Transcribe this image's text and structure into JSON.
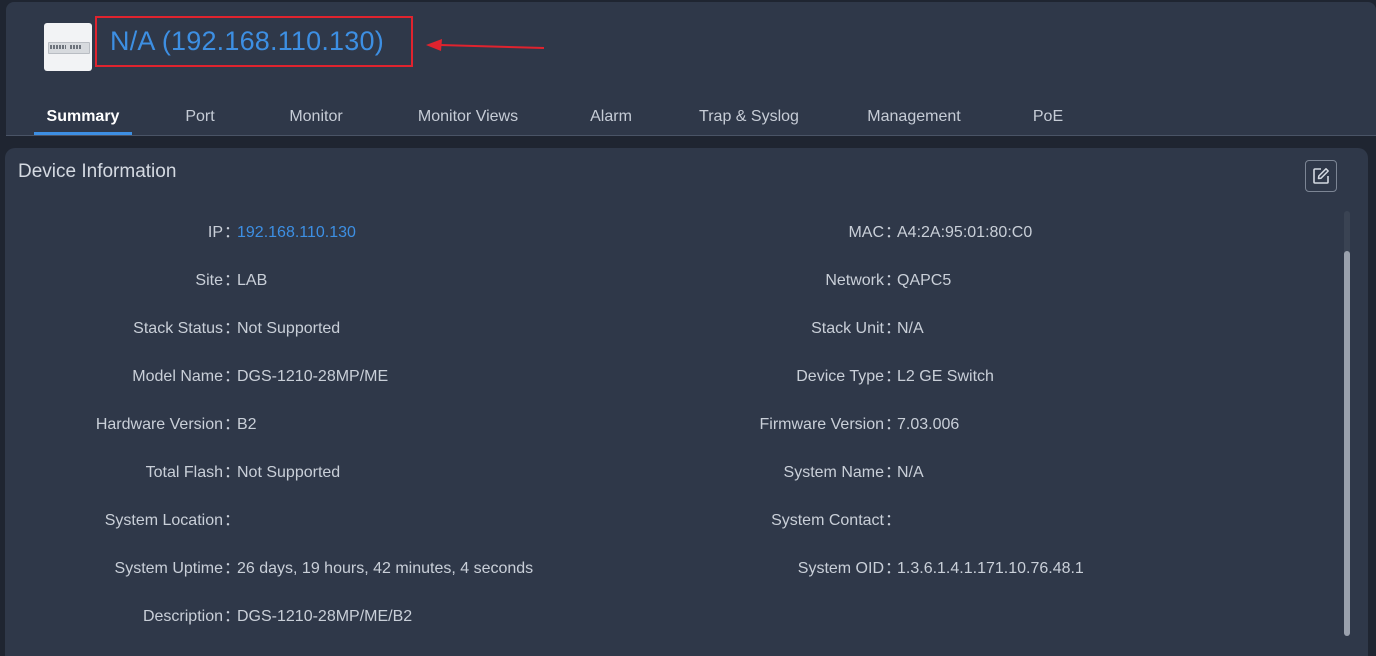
{
  "device": {
    "title": "N/A (192.168.110.130)"
  },
  "tabs": [
    "Summary",
    "Port",
    "Monitor",
    "Monitor Views",
    "Alarm",
    "Trap & Syslog",
    "Management",
    "PoE"
  ],
  "panel": {
    "title": "Device Information"
  },
  "colon": "：",
  "info_left": [
    {
      "label": "IP",
      "value": "192.168.110.130"
    },
    {
      "label": "Site",
      "value": "LAB"
    },
    {
      "label": "Stack Status",
      "value": "Not Supported"
    },
    {
      "label": "Model Name",
      "value": "DGS-1210-28MP/ME"
    },
    {
      "label": "Hardware Version",
      "value": "B2"
    },
    {
      "label": "Total Flash",
      "value": "Not Supported"
    },
    {
      "label": "System Location",
      "value": ""
    },
    {
      "label": "System Uptime",
      "value": "26 days, 19 hours, 42 minutes, 4 seconds"
    },
    {
      "label": "Description",
      "value": "DGS-1210-28MP/ME/B2"
    }
  ],
  "info_right": [
    {
      "label": "MAC",
      "value": "A4:2A:95:01:80:C0"
    },
    {
      "label": "Network",
      "value": "QAPC5"
    },
    {
      "label": "Stack Unit",
      "value": "N/A"
    },
    {
      "label": "Device Type",
      "value": "L2 GE Switch"
    },
    {
      "label": "Firmware Version",
      "value": "7.03.006"
    },
    {
      "label": "System Name",
      "value": "N/A"
    },
    {
      "label": "System Contact",
      "value": ""
    },
    {
      "label": "System OID",
      "value": "1.3.6.1.4.1.171.10.76.48.1"
    }
  ],
  "icons": {
    "device": "switch-device-icon",
    "edit": "edit-icon",
    "annotation": "red-arrow-icon"
  },
  "colors": {
    "accent": "#3d8fe3",
    "highlight": "#e0232e"
  }
}
